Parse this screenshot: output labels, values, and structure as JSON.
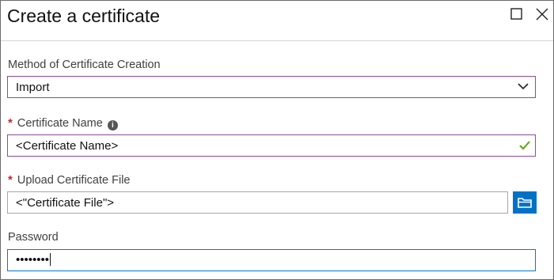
{
  "window": {
    "title": "Create a certificate"
  },
  "method": {
    "label": "Method of Certificate Creation",
    "value": "Import"
  },
  "cert_name": {
    "required_mark": "*",
    "label": "Certificate Name",
    "value": "<Certificate Name>"
  },
  "upload": {
    "required_mark": "*",
    "label": "Upload Certificate File",
    "value": "<\"Certificate File\">"
  },
  "password": {
    "label": "Password",
    "value": "••••••••"
  },
  "colors": {
    "accent": "#0072c6",
    "invalid_border": "#8e4a9c",
    "valid_check": "#5ea40b",
    "required": "#c4262e"
  }
}
